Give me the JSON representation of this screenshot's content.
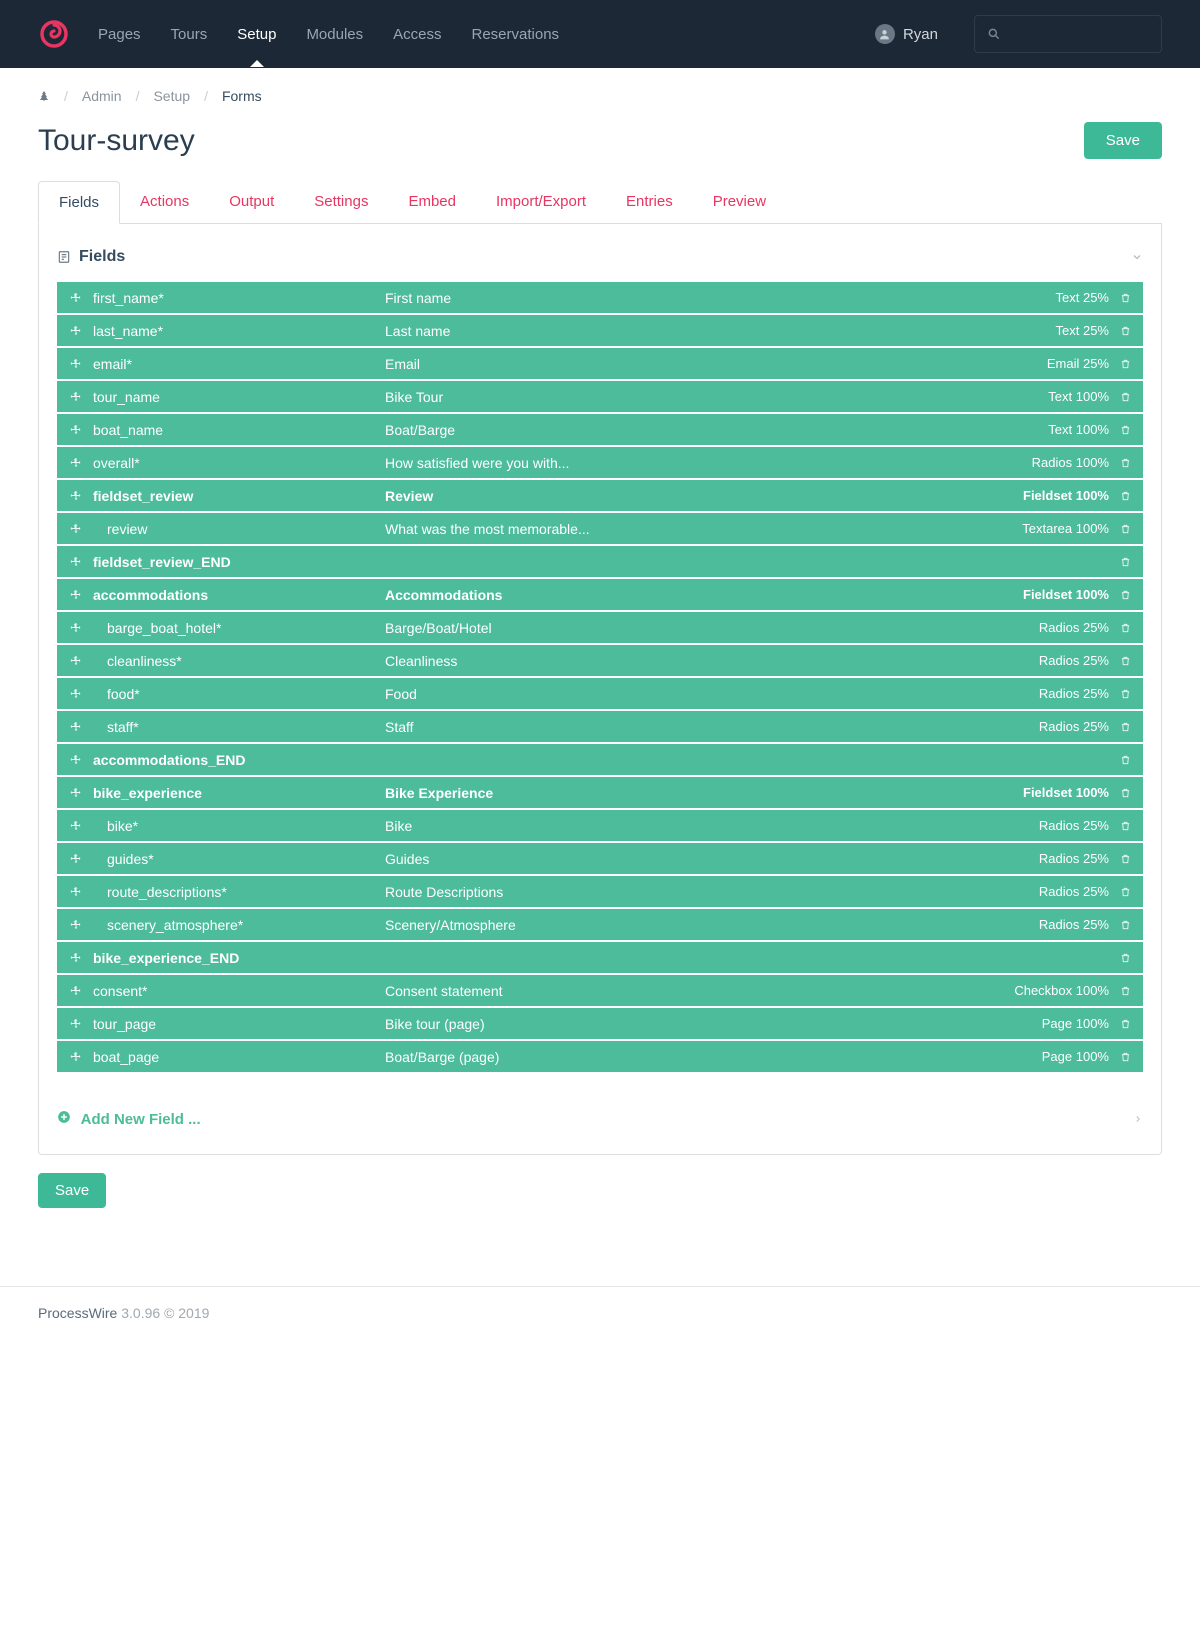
{
  "nav": {
    "items": [
      {
        "label": "Pages",
        "active": false
      },
      {
        "label": "Tours",
        "active": false
      },
      {
        "label": "Setup",
        "active": true
      },
      {
        "label": "Modules",
        "active": false
      },
      {
        "label": "Access",
        "active": false
      },
      {
        "label": "Reservations",
        "active": false
      }
    ]
  },
  "user": {
    "name": "Ryan"
  },
  "breadcrumb": {
    "items": [
      "Admin",
      "Setup",
      "Forms"
    ]
  },
  "page": {
    "title": "Tour-survey",
    "save_label": "Save"
  },
  "tabs": [
    {
      "label": "Fields",
      "active": true
    },
    {
      "label": "Actions"
    },
    {
      "label": "Output"
    },
    {
      "label": "Settings"
    },
    {
      "label": "Embed"
    },
    {
      "label": "Import/Export"
    },
    {
      "label": "Entries"
    },
    {
      "label": "Preview"
    }
  ],
  "section": {
    "title": "Fields",
    "add_label": "Add New Field ..."
  },
  "fields": [
    {
      "name": "first_name*",
      "label": "First name",
      "type": "Text 25%",
      "indent": false,
      "bold": false
    },
    {
      "name": "last_name*",
      "label": "Last name",
      "type": "Text 25%",
      "indent": false,
      "bold": false
    },
    {
      "name": "email*",
      "label": "Email",
      "type": "Email 25%",
      "indent": false,
      "bold": false
    },
    {
      "name": "tour_name",
      "label": "Bike Tour",
      "type": "Text 100%",
      "indent": false,
      "bold": false
    },
    {
      "name": "boat_name",
      "label": "Boat/Barge",
      "type": "Text 100%",
      "indent": false,
      "bold": false
    },
    {
      "name": "overall*",
      "label": "How satisfied were you with...",
      "type": "Radios 100%",
      "indent": false,
      "bold": false
    },
    {
      "name": "fieldset_review",
      "label": "Review",
      "type": "Fieldset 100%",
      "indent": false,
      "bold": true
    },
    {
      "name": "review",
      "label": "What was the most memorable...",
      "type": "Textarea 100%",
      "indent": true,
      "bold": false
    },
    {
      "name": "fieldset_review_END",
      "label": "",
      "type": "",
      "indent": false,
      "bold": true
    },
    {
      "name": "accommodations",
      "label": "Accommodations",
      "type": "Fieldset 100%",
      "indent": false,
      "bold": true
    },
    {
      "name": "barge_boat_hotel*",
      "label": "Barge/Boat/Hotel",
      "type": "Radios 25%",
      "indent": true,
      "bold": false
    },
    {
      "name": "cleanliness*",
      "label": "Cleanliness",
      "type": "Radios 25%",
      "indent": true,
      "bold": false
    },
    {
      "name": "food*",
      "label": "Food",
      "type": "Radios 25%",
      "indent": true,
      "bold": false
    },
    {
      "name": "staff*",
      "label": "Staff",
      "type": "Radios 25%",
      "indent": true,
      "bold": false
    },
    {
      "name": "accommodations_END",
      "label": "",
      "type": "",
      "indent": false,
      "bold": true
    },
    {
      "name": "bike_experience",
      "label": "Bike Experience",
      "type": "Fieldset 100%",
      "indent": false,
      "bold": true
    },
    {
      "name": "bike*",
      "label": "Bike",
      "type": "Radios 25%",
      "indent": true,
      "bold": false
    },
    {
      "name": "guides*",
      "label": "Guides",
      "type": "Radios 25%",
      "indent": true,
      "bold": false
    },
    {
      "name": "route_descriptions*",
      "label": "Route Descriptions",
      "type": "Radios 25%",
      "indent": true,
      "bold": false
    },
    {
      "name": "scenery_atmosphere*",
      "label": "Scenery/Atmosphere",
      "type": "Radios 25%",
      "indent": true,
      "bold": false
    },
    {
      "name": "bike_experience_END",
      "label": "",
      "type": "",
      "indent": false,
      "bold": true
    },
    {
      "name": "consent*",
      "label": "Consent statement",
      "type": "Checkbox 100%",
      "indent": false,
      "bold": false
    },
    {
      "name": "tour_page",
      "label": "Bike tour (page)",
      "type": "Page 100%",
      "indent": false,
      "bold": false
    },
    {
      "name": "boat_page",
      "label": "Boat/Barge (page)",
      "type": "Page 100%",
      "indent": false,
      "bold": false
    }
  ],
  "footer": {
    "product": "ProcessWire",
    "version": "3.0.96 © 2019"
  }
}
